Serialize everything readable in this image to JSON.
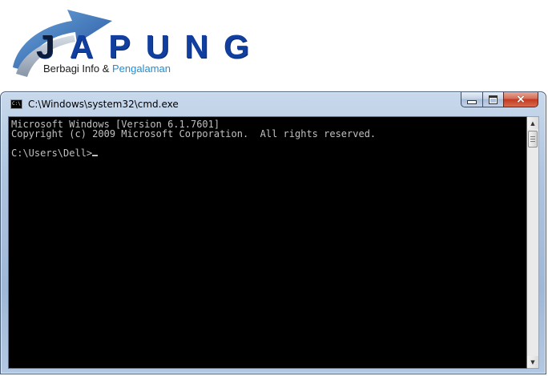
{
  "logo": {
    "title_first": "J",
    "title_rest": "APUNG",
    "tagline_main": "Berbagi Info & ",
    "tagline_highlight": "Pengalaman",
    "colors": {
      "brand": "#113fa0",
      "accent": "#1c8fd6"
    }
  },
  "window": {
    "icon": "cmd-icon",
    "icon_text": "C:\\",
    "title": "C:\\Windows\\system32\\cmd.exe",
    "controls": {
      "minimize_icon": "minimize-icon",
      "maximize_icon": "maximize-icon",
      "close_icon": "close-icon",
      "close_glyph": "×"
    }
  },
  "console": {
    "line1": "Microsoft Windows [Version 6.1.7601]",
    "line2": "Copyright (c) 2009 Microsoft Corporation.  All rights reserved.",
    "line3": "",
    "prompt": "C:\\Users\\Dell>"
  },
  "scrollbar": {
    "up_icon": "scroll-up-arrow-icon",
    "down_icon": "scroll-down-arrow-icon"
  }
}
